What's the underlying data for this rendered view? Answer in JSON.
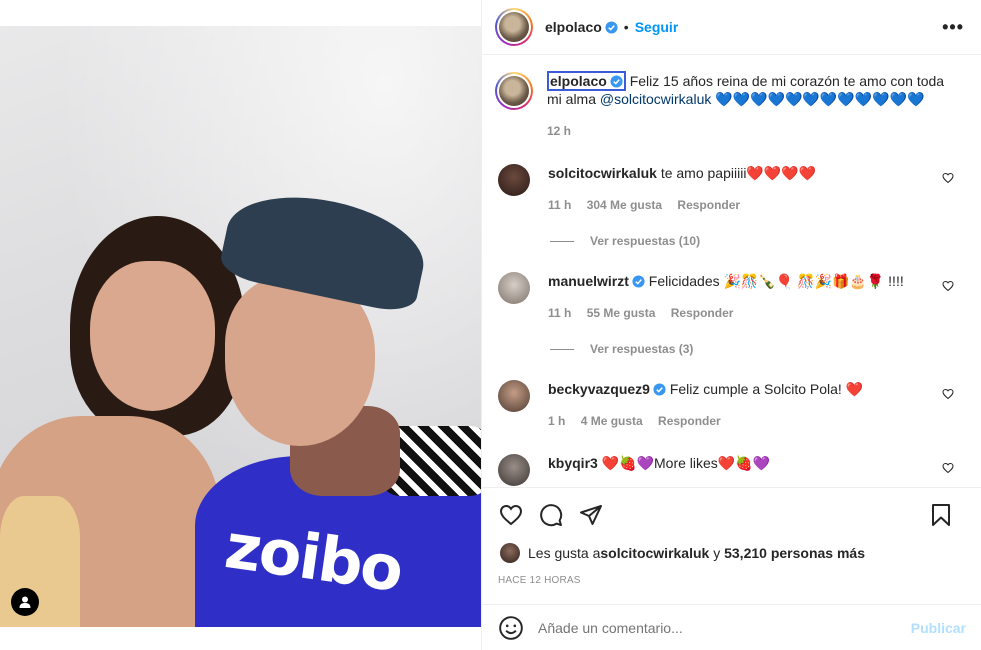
{
  "post": {
    "username": "elpolaco",
    "follow_label": "Seguir",
    "more_label": "•••",
    "dot": "•"
  },
  "caption": {
    "username": "elpolaco",
    "text": "Feliz 15 años reina de mi corazón te amo con toda mi alma ",
    "mention": "@solcitocwirkaluk",
    "emojis": " 💙💙💙💙💙💙💙💙💙💙💙💙",
    "time": "12 h"
  },
  "comments": [
    {
      "username": "solcitocwirkaluk",
      "text": "te amo papiiiii❤️❤️❤️❤️",
      "time": "11 h",
      "likes": "304 Me gusta",
      "reply": "Responder",
      "view_replies": "Ver respuestas (10)",
      "avatar_color": "#3a2a26"
    },
    {
      "username": "manuelwirzt",
      "verified": true,
      "text": "Felicidades 🎉🎊🍾🎈  🎊🎉🎁🎂🌹 !!!!",
      "time": "11 h",
      "likes": "55 Me gusta",
      "reply": "Responder",
      "view_replies": "Ver respuestas (3)",
      "avatar_color": "#a89f97"
    },
    {
      "username": "beckyvazquez9",
      "verified": true,
      "text": "Feliz cumple a Solcito Pola! ❤️",
      "time": "1 h",
      "likes": "4 Me gusta",
      "reply": "Responder",
      "avatar_color": "#8a6d60"
    },
    {
      "username": "kbyqir3",
      "text": "❤️🍓💜More likes❤️🍓💜",
      "avatar_color": "#5b5350"
    }
  ],
  "likes": {
    "prefix": "Les gusta a ",
    "user": "solcitocwirkaluk",
    "mid": " y ",
    "count": "53,210 personas más"
  },
  "timestamp": "HACE 12 HORAS",
  "add_comment": {
    "placeholder": "Añade un comentario...",
    "post_label": "Publicar"
  },
  "media": {
    "shirt_text": "zoibo"
  },
  "colors": {
    "accent": "#0095f6",
    "verified": "#3897f0",
    "muted": "#8e8e8e",
    "post_disabled": "#b2dffc"
  }
}
